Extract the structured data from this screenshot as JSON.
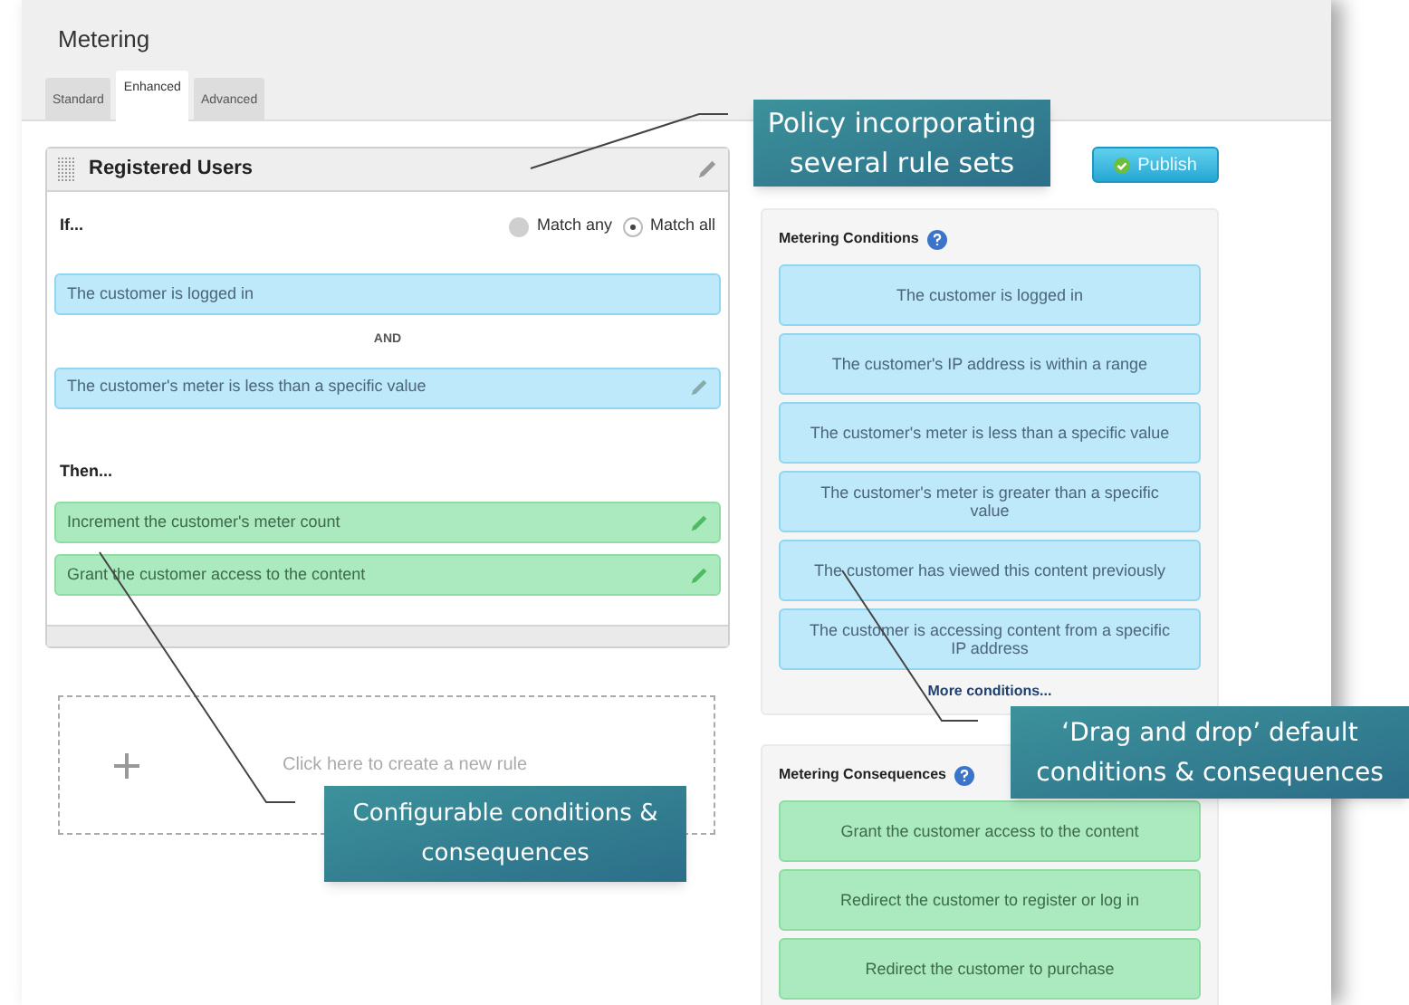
{
  "window": {
    "title": "Metering"
  },
  "tabs": [
    {
      "label": "Standard",
      "selected": false
    },
    {
      "label": "Enhanced",
      "selected": true
    },
    {
      "label": "Advanced",
      "selected": false
    }
  ],
  "rule": {
    "title": "Registered Users",
    "if_label": "If...",
    "match_options": [
      {
        "label": "Match any",
        "selected": false
      },
      {
        "label": "Match all",
        "selected": true
      }
    ],
    "conditions": [
      {
        "text": "The customer is logged in",
        "editable": false
      },
      {
        "text": "The customer's meter is less than a specific value",
        "editable": true
      }
    ],
    "joiner": "AND",
    "then_label": "Then...",
    "consequences": [
      {
        "text": "Increment the customer's meter count",
        "editable": true
      },
      {
        "text": "Grant the customer access to the content",
        "editable": true
      }
    ]
  },
  "new_rule": {
    "text": "Click here to create a new rule"
  },
  "publish_button": "Publish",
  "conditions_panel": {
    "title": "Metering Conditions",
    "items": [
      "The customer is logged in",
      "The customer's IP address is within a range",
      "The customer's meter is less than a specific value",
      "The customer's meter is greater than a specific value",
      "The customer has viewed this content previously",
      "The customer is accessing content from a specific IP address"
    ],
    "more_link": "More conditions..."
  },
  "consequences_panel": {
    "title": "Metering Consequences",
    "items": [
      "Grant the customer access to the content",
      "Redirect the customer to register or log in",
      "Redirect the customer to purchase"
    ]
  },
  "callouts": [
    {
      "text": "Policy incorporating several rule sets"
    },
    {
      "text": "Configurable conditions & consequences"
    },
    {
      "text": "‘Drag and drop’ default conditions & consequences"
    }
  ]
}
